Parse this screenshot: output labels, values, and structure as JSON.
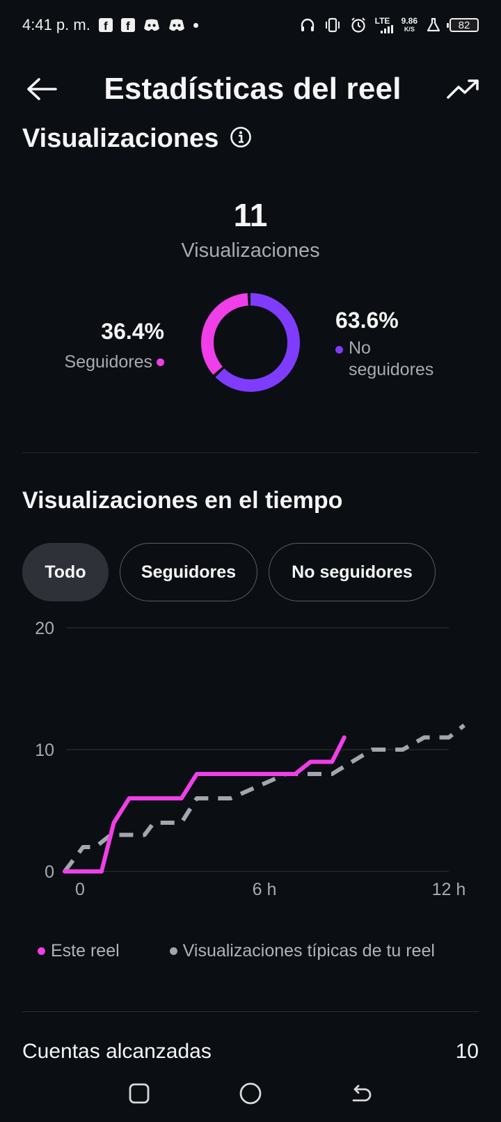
{
  "status_bar": {
    "time": "4:41 p. m.",
    "lte": "LTE",
    "net_speed_value": "9.86",
    "net_speed_unit": "K/S",
    "battery": "82",
    "icons": [
      "facebook-icon",
      "facebook-icon",
      "discord-icon",
      "discord-icon",
      "dot-icon",
      "headphones-icon",
      "vibrate-icon",
      "alarm-icon",
      "signal-icon",
      "flask-icon",
      "battery-icon"
    ]
  },
  "header": {
    "title": "Estadísticas del reel",
    "back_icon": "arrow-left-icon",
    "trend_icon": "trending-up-icon"
  },
  "views": {
    "section_title": "Visualizaciones",
    "info_icon": "info-icon",
    "total": "11",
    "total_label": "Visualizaciones",
    "followers_pct": "36.4%",
    "followers_label": "Seguidores",
    "non_followers_pct": "63.6%",
    "non_followers_label_1": "No",
    "non_followers_label_2": "seguidores",
    "followers_fraction": 0.364,
    "non_followers_fraction": 0.636
  },
  "colors": {
    "followers": "#f03ee8",
    "non_followers": "#7f3cff",
    "this_reel": "#f03ee8",
    "typical": "#a3a6ac",
    "background": "#0b0e13",
    "grid": "#2a2d33"
  },
  "time_section": {
    "title": "Visualizaciones en el tiempo",
    "chips": [
      {
        "label": "Todo",
        "active": true
      },
      {
        "label": "Seguidores",
        "active": false
      },
      {
        "label": "No seguidores",
        "active": false
      }
    ]
  },
  "chart_data": {
    "type": "line",
    "y_ticks": [
      "0",
      "10",
      "20"
    ],
    "x_ticks": [
      "0",
      "6 h",
      "12 h"
    ],
    "ylim": [
      0,
      20
    ],
    "xlim": [
      0,
      12
    ],
    "grid": true,
    "legend_position": "bottom",
    "series": [
      {
        "name": "Este reel",
        "style": "solid",
        "points": [
          [
            -0.5,
            0
          ],
          [
            0.7,
            0
          ],
          [
            1.1,
            4
          ],
          [
            1.6,
            6
          ],
          [
            3.3,
            6
          ],
          [
            3.8,
            8
          ],
          [
            7.0,
            8
          ],
          [
            7.5,
            9
          ],
          [
            8.2,
            9
          ],
          [
            8.6,
            11
          ]
        ]
      },
      {
        "name": "Visualizaciones típicas de tu reel",
        "style": "dashed",
        "points": [
          [
            -0.5,
            0
          ],
          [
            0.1,
            2
          ],
          [
            0.5,
            2
          ],
          [
            1.0,
            3
          ],
          [
            2.1,
            3
          ],
          [
            2.4,
            4
          ],
          [
            3.3,
            4
          ],
          [
            3.8,
            6
          ],
          [
            4.9,
            6
          ],
          [
            6.7,
            8
          ],
          [
            8.2,
            8
          ],
          [
            9.5,
            10
          ],
          [
            10.5,
            10
          ],
          [
            11.2,
            11
          ],
          [
            12.0,
            11
          ],
          [
            12.5,
            12
          ]
        ]
      }
    ]
  },
  "reach": {
    "label": "Cuentas alcanzadas",
    "value": "10"
  },
  "nav": {
    "recents_icon": "square-icon",
    "home_icon": "circle-icon",
    "back_icon": "back-arrow-icon"
  }
}
